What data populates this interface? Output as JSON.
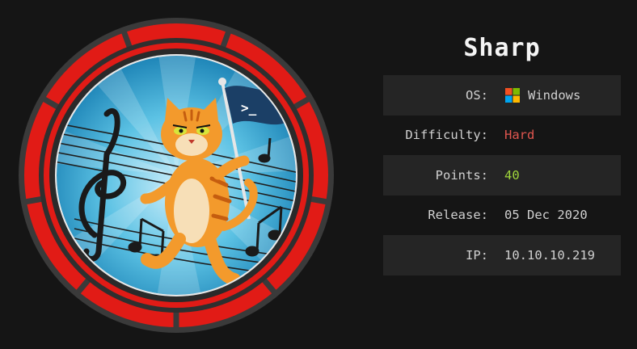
{
  "machine": {
    "name": "Sharp"
  },
  "info": {
    "os": {
      "label": "OS:",
      "value": "Windows",
      "icon": "windows-logo-icon"
    },
    "difficulty": {
      "label": "Difficulty:",
      "value": "Hard",
      "color": "#e0564f"
    },
    "points": {
      "label": "Points:",
      "value": "40",
      "color": "#9fd53b"
    },
    "release": {
      "label": "Release:",
      "value": "05 Dec 2020"
    },
    "ip": {
      "label": "IP:",
      "value": "10.10.10.219"
    }
  },
  "badge": {
    "icon": "machine-avatar-cat-with-flag",
    "flag_text": ">_",
    "ring_color": "#e11b16"
  }
}
